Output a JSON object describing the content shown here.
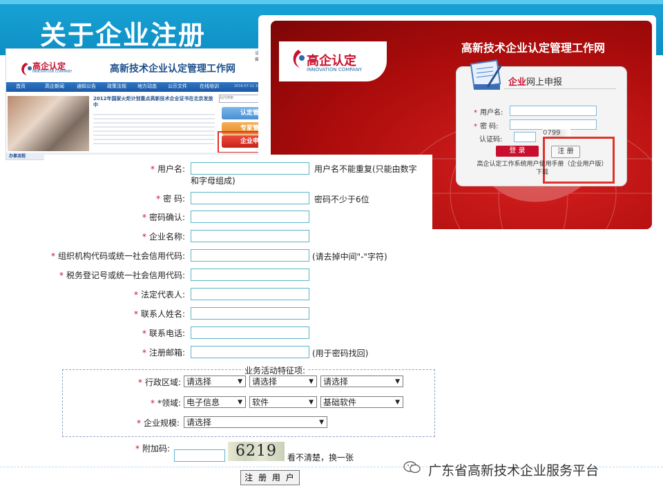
{
  "slide": {
    "title": "关于企业注册"
  },
  "website": {
    "top_links": "设为首页 | 加入收藏",
    "logo_text": "高企认定",
    "logo_sub": "INNOVATION COMPANY",
    "title": "高新技术企业认定管理工作网",
    "nav": [
      "首页",
      "高企新闻",
      "通知公告",
      "政策法规",
      "地方动态",
      "公示文件",
      "在线培训"
    ],
    "date": "2016-07-11 10:18:28 星期一",
    "news_title": "2012年国家火炬计划重点高新技术企业证书在北京发放中",
    "search_placeholder": "站内搜索",
    "search_button": "搜索",
    "buttons": [
      "认定管理",
      "专家管理",
      "企业申报"
    ],
    "footer_label": "办事流程"
  },
  "login": {
    "logo_text": "高企认定",
    "logo_sub": "INNOVATION COMPANY",
    "header_title": "高新技术企业认定管理工作网",
    "card_title_prefix": "企业",
    "card_title_rest": "网上申报",
    "username_label": "用户名:",
    "password_label": "密  码:",
    "captcha_label": "认证码:",
    "captcha_value": "0799",
    "login_button": "登 录",
    "register_button": "注 册",
    "manual_text": "高企认定工作系统用户使用手册（企业用户版）下载"
  },
  "form": {
    "fields": [
      {
        "label": "用户名:",
        "hint": "用户名不能重复(只能由数字",
        "hint2": "和字母组成)"
      },
      {
        "label": "密  码:",
        "hint": "密码不少于6位"
      },
      {
        "label": "密码确认:",
        "hint": ""
      },
      {
        "label": "企业名称:",
        "hint": ""
      },
      {
        "label": "组织机构代码或统一社会信用代码:",
        "hint": "(请去掉中间\"-\"字符)"
      },
      {
        "label": "税务登记号或统一社会信用代码:",
        "hint": ""
      },
      {
        "label": "法定代表人:",
        "hint": ""
      },
      {
        "label": "联系人姓名:",
        "hint": ""
      },
      {
        "label": "联系电话:",
        "hint": ""
      },
      {
        "label": "注册邮箱:",
        "hint": "(用于密码找回)"
      }
    ],
    "business_title": "业务活动特征项:",
    "region_label": "行政区域:",
    "region_selects": [
      "请选择",
      "请选择",
      "请选择"
    ],
    "domain_label": "*领域:",
    "domain_selects": [
      "电子信息",
      "软件",
      "基础软件"
    ],
    "scale_label": "企业规模:",
    "scale_select": "请选择",
    "captcha_label": "附加码:",
    "captcha_image_text": "6219",
    "captcha_refresh": "看不清楚，换一张",
    "submit": "注 册 用 户"
  },
  "watermark": {
    "text": "广东省高新技术企业服务平台"
  }
}
